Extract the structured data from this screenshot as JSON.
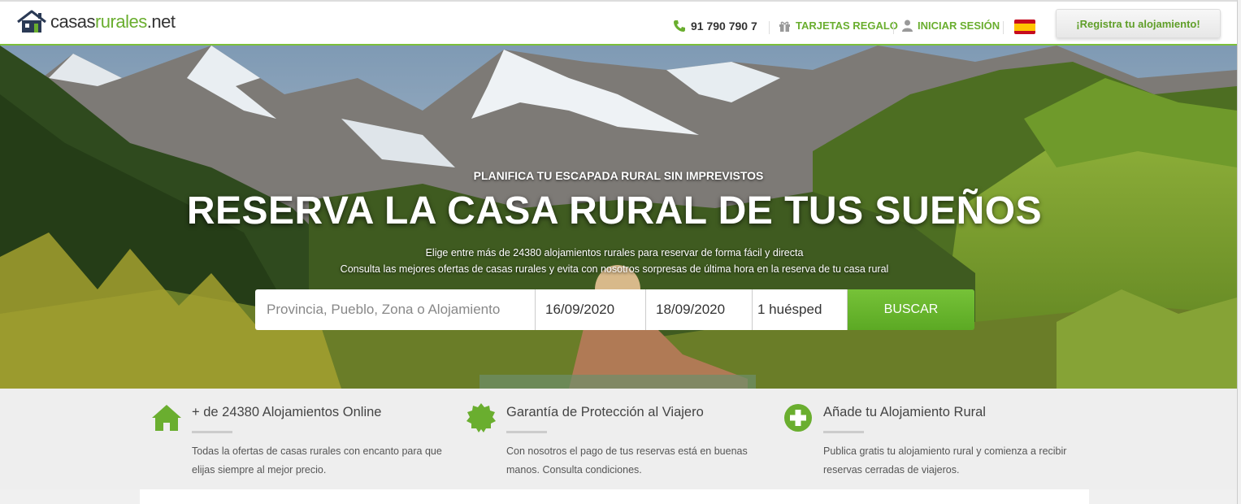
{
  "header": {
    "logo_text_a": "casas",
    "logo_text_b": "rurales",
    "logo_text_c": ".net",
    "phone": "91 790 790 7",
    "gift_cards": "TARJETAS REGALO",
    "login": "INICIAR SESIÓN",
    "register_button": "¡Registra tu alojamiento!",
    "brand_color": "#6aae2f"
  },
  "hero": {
    "kicker": "PLANIFICA TU ESCAPADA RURAL SIN IMPREVISTOS",
    "title": "RESERVA LA CASA RURAL DE TUS SUEÑOS",
    "line1": "Elige entre más de 24380 alojamientos rurales para reservar de forma fácil y directa",
    "line2": "Consulta las mejores ofertas de casas rurales y evita con nosotros sorpresas de última hora en la reserva de tu casa rural"
  },
  "search": {
    "where_placeholder": "Provincia, Pueblo, Zona o Alojamiento",
    "checkin": "16/09/2020",
    "checkout": "18/09/2020",
    "guests": "1 huésped",
    "button": "BUSCAR"
  },
  "features": [
    {
      "icon": "house-icon",
      "title": "+ de 24380 Alojamientos Online",
      "desc": "Todas la ofertas de casas rurales con encanto para que elijas siempre al mejor precio."
    },
    {
      "icon": "badge-icon",
      "title": "Garantía de Protección al Viajero",
      "desc": "Con nosotros el pago de tus reservas está en buenas manos. Consulta condiciones."
    },
    {
      "icon": "plus-circle-icon",
      "title": "Añade tu Alojamiento Rural",
      "desc": "Publica gratis tu alojamiento rural y comienza a recibir reservas cerradas de viajeros."
    }
  ]
}
